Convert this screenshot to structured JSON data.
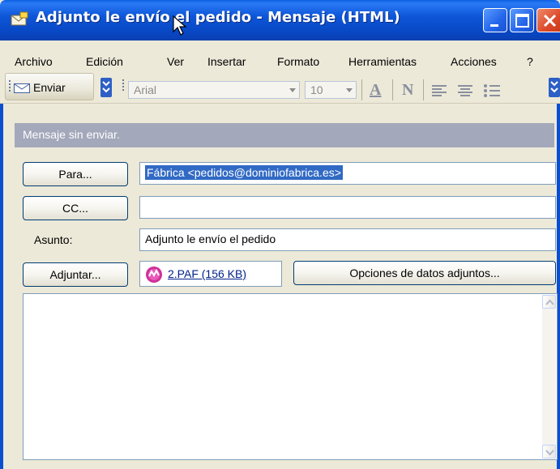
{
  "window": {
    "title": "Adjunto le envío el pedido - Mensaje (HTML)"
  },
  "menubar": {
    "items": [
      {
        "label": "Archivo"
      },
      {
        "label": "Edición"
      },
      {
        "label": "Ver"
      },
      {
        "label": "Insertar"
      },
      {
        "label": "Formato"
      },
      {
        "label": "Herramientas"
      },
      {
        "label": "Acciones"
      },
      {
        "label": "?"
      }
    ]
  },
  "toolbar": {
    "send_label": "Enviar",
    "font_value": "Arial",
    "size_value": "10",
    "icons": [
      "send-icon",
      "font-color-icon",
      "bold-icon",
      "align-left-icon",
      "align-center-icon",
      "bullets-icon"
    ]
  },
  "status": {
    "text": "Mensaje sin enviar."
  },
  "header": {
    "to_button": "Para...",
    "to_value": "Fábrica <pedidos@dominiofabrica.es>",
    "cc_button": "CC...",
    "cc_value": "",
    "subject_label": "Asunto:",
    "subject_value": "Adjunto le envío el pedido",
    "attach_button": "Adjuntar...",
    "attachment_name": "2.PAF (156 KB)",
    "attach_options_button": "Opciones de datos adjuntos..."
  },
  "colors": {
    "titlebar": "#0a50d8",
    "status_bar": "#a3a8ba",
    "selection": "#316ac5",
    "link": "#00208a"
  }
}
